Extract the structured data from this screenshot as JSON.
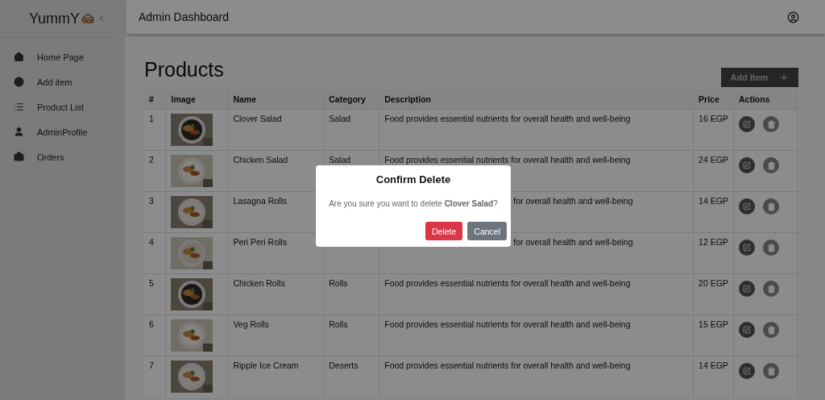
{
  "sidebar": {
    "logo": "YummY",
    "items": [
      {
        "label": "Home Page"
      },
      {
        "label": "Add item"
      },
      {
        "label": "Product List"
      },
      {
        "label": "AdminProfile"
      },
      {
        "label": "Orders"
      }
    ]
  },
  "header": {
    "title": "Admin Dashboard"
  },
  "page": {
    "title": "Products",
    "add_button": "Add Item"
  },
  "table": {
    "columns": [
      "#",
      "Image",
      "Name",
      "Category",
      "Description",
      "Price",
      "Actions"
    ],
    "rows": [
      {
        "index": "1",
        "name": "Clover Salad",
        "category": "Salad",
        "description": "Food provides essential nutrients for overall health and well-being",
        "price": "16 EGP"
      },
      {
        "index": "2",
        "name": "Chicken Salad",
        "category": "Salad",
        "description": "Food provides essential nutrients for overall health and well-being",
        "price": "24 EGP"
      },
      {
        "index": "3",
        "name": "Lasagna Rolls",
        "description_visible_part": "for overall health and well-being",
        "price": "14 EGP"
      },
      {
        "index": "4",
        "name": "Peri Peri Rolls",
        "description_visible_part": "for overall health and well-being",
        "price": "12 EGP"
      },
      {
        "index": "5",
        "name": "Chicken Rolls",
        "category": "Rolls",
        "description": "Food provides essential nutrients for overall health and well-being",
        "price": "20 EGP"
      },
      {
        "index": "6",
        "name": "Veg Rolls",
        "category": "Rolls",
        "description": "Food provides essential nutrients for overall health and well-being",
        "price": "15 EGP"
      },
      {
        "index": "7",
        "name": "Ripple Ice Cream",
        "category": "Deserts",
        "description": "Food provides essential nutrients for overall health and well-being",
        "price": "14 EGP"
      }
    ]
  },
  "dialog": {
    "title": "Confirm Delete",
    "message": "Are you sure you want to delete **Clover Salad**?",
    "confirm": "Delete",
    "cancel": "Cancel"
  }
}
